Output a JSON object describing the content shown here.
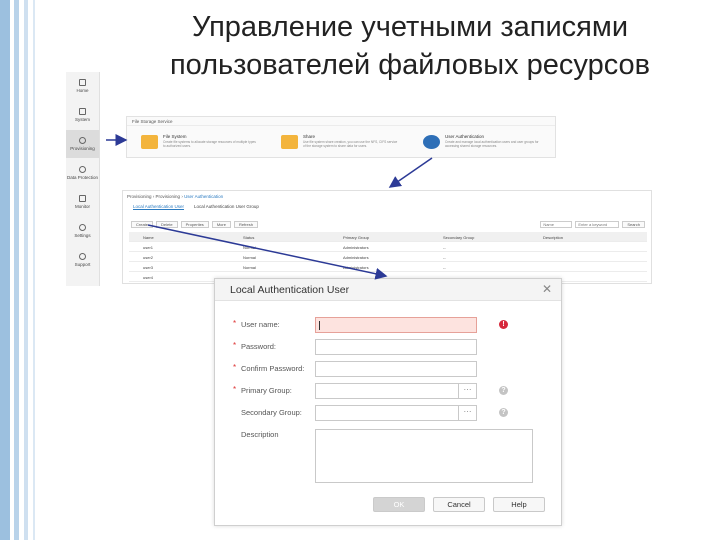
{
  "slide": {
    "title_line1": "Управление учетными записями",
    "title_line2": "пользователей файловых ресурсов"
  },
  "nav": {
    "items": [
      {
        "label": "Home",
        "icon": "home-icon"
      },
      {
        "label": "System",
        "icon": "server-icon"
      },
      {
        "label": "Provisioning",
        "icon": "gear-icon"
      },
      {
        "label": "Data Protection",
        "icon": "shield-icon"
      },
      {
        "label": "Monitor",
        "icon": "monitor-icon"
      },
      {
        "label": "Settings",
        "icon": "settings-icon"
      },
      {
        "label": "Support",
        "icon": "help-icon"
      }
    ]
  },
  "file_panel": {
    "header": "File Storage Service",
    "cards": [
      {
        "title": "File System",
        "desc": "Create file systems to allocate storage resources of multiple types to authorized users.",
        "icon": "filesystem-icon",
        "color": "#f3b43c"
      },
      {
        "title": "Share",
        "desc": "Use file system share creation, you can use the NFS, CIFS service of the storage system to share data for users.",
        "icon": "share-icon",
        "color": "#f3b43c"
      },
      {
        "title": "User Authentication",
        "desc": "Create and manage local authentication users and user groups for accessing shared storage resources.",
        "icon": "user-icon",
        "color": "#2e6fb7"
      }
    ]
  },
  "list_window": {
    "breadcrumb_prefix": "Provisioning",
    "breadcrumb_mid": "Provisioning",
    "breadcrumb_link": "User Authentication",
    "tabs": [
      "Local Authentication User",
      "Local Authentication User Group"
    ],
    "toolbar": [
      "Create",
      "Delete",
      "Properties",
      "More",
      "Refresh"
    ],
    "search_label": "Name",
    "search_placeholder": "Enter a keyword",
    "search_button": "Search",
    "columns": [
      "Name",
      "Status",
      "Primary Group",
      "Secondary Group",
      "Description"
    ],
    "rows": [
      {
        "name": "user1",
        "status": "Normal",
        "primary": "Administrators",
        "secondary": "--"
      },
      {
        "name": "user2",
        "status": "Normal",
        "primary": "Administrators",
        "secondary": "--"
      },
      {
        "name": "user3",
        "status": "Normal",
        "primary": "Administrators",
        "secondary": "--"
      },
      {
        "name": "user4",
        "status": "",
        "primary": "",
        "secondary": ""
      }
    ]
  },
  "dialog": {
    "title": "Local Authentication User",
    "close_glyph": "✕",
    "fields": {
      "username_label": "User name:",
      "password_label": "Password:",
      "confirm_label": "Confirm Password:",
      "primary_group_label": "Primary Group:",
      "secondary_group_label": "Secondary Group:",
      "description_label": "Description"
    },
    "required_mark": "*",
    "select_dots": "···",
    "error_glyph": "!",
    "help_glyph": "?",
    "buttons": {
      "ok": "OK",
      "cancel": "Cancel",
      "help": "Help"
    }
  },
  "colors": {
    "accent": "#2a7ac0",
    "arrow": "#2c3a96",
    "error": "#d6283b"
  }
}
